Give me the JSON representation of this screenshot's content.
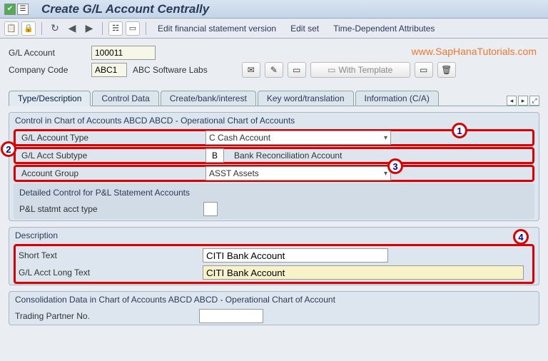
{
  "title": "Create G/L Account Centrally",
  "watermark": "www.SapHanaTutorials.com",
  "menu": {
    "m1": "Edit financial statement version",
    "m2": "Edit set",
    "m3": "Time-Dependent Attributes"
  },
  "form": {
    "gl_label": "G/L Account",
    "gl_value": "100011",
    "cc_label": "Company Code",
    "cc_value": "ABC1",
    "cc_desc": "ABC Software Labs"
  },
  "template_btn": "With Template",
  "tabs": [
    "Type/Description",
    "Control Data",
    "Create/bank/interest",
    "Key word/translation",
    "Information (C/A)"
  ],
  "g1": {
    "header": "Control in Chart of Accounts ABCD ABCD - Operational Chart of Accounts",
    "r1_lbl": "G/L Account Type",
    "r1_val": "C Cash Account",
    "r2_lbl": "G/L Acct Subtype",
    "r2_code": "B",
    "r2_desc": "Bank Reconciliation Account",
    "r3_lbl": "Account Group",
    "r3_val": "ASST Assets",
    "sub_header": "Detailed Control for P&L Statement Accounts",
    "sub_r1_lbl": "P&L statmt acct type"
  },
  "g2": {
    "header": "Description",
    "r1_lbl": "Short Text",
    "r1_val": "CITI Bank Account",
    "r2_lbl": "G/L Acct Long Text",
    "r2_val": "CITI Bank Account"
  },
  "g3": {
    "header": "Consolidation Data in Chart of Accounts ABCD ABCD - Operational Chart of Account",
    "r1_lbl": "Trading Partner No."
  },
  "annot": {
    "a1": "1",
    "a2": "2",
    "a3": "3",
    "a4": "4"
  }
}
